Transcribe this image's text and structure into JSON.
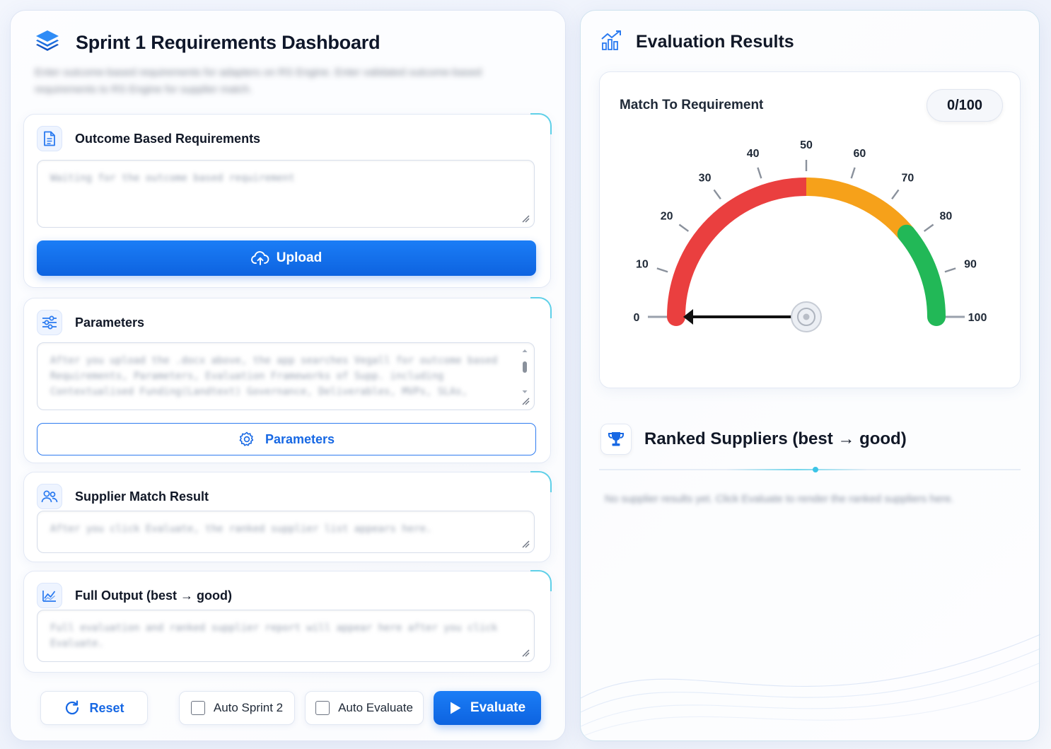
{
  "header": {
    "title": "Sprint 1 Requirements Dashboard",
    "subtitle": "Enter outcome-based requirements for adapters on RS Engine. Enter validated outcome-based requirements to RS Engine for supplier match."
  },
  "outcome": {
    "title": "Outcome Based Requirements",
    "placeholder": "Waiting for the outcome based requirement",
    "upload_label": "Upload"
  },
  "parameters": {
    "title": "Parameters",
    "placeholder": "After you upload the .docx above, the app searches Vegall for outcome based Requirements, Parameters, Evaluation Frameworks of Supp. including Contextualised Funding(Landtext) Governance, Deliverables, MVPs, SLAs,",
    "button_label": "Parameters"
  },
  "supplier_match": {
    "title": "Supplier Match Result",
    "placeholder": "After you click Evaluate, the ranked supplier list appears here."
  },
  "full_output": {
    "title": "Full Output (best → good)",
    "placeholder": "Full evaluation and ranked supplier report will appear here after you click Evaluate."
  },
  "footer": {
    "reset_label": "Reset",
    "auto_sprint2_label": "Auto Sprint 2",
    "auto_sprint2_checked": false,
    "auto_evaluate_label": "Auto Evaluate",
    "auto_evaluate_checked": false,
    "evaluate_label": "Evaluate"
  },
  "results": {
    "title": "Evaluation Results",
    "gauge_label": "Match To Requirement",
    "score_display": "0/100",
    "score": 0,
    "ticks": [
      "0",
      "10",
      "20",
      "30",
      "40",
      "50",
      "60",
      "70",
      "80",
      "90",
      "100"
    ],
    "bands": [
      {
        "from": 0,
        "to": 50,
        "color": "#ea3f3f"
      },
      {
        "from": 50,
        "to": 78,
        "color": "#f6a11a"
      },
      {
        "from": 78,
        "to": 100,
        "color": "#22b857"
      }
    ]
  },
  "ranked": {
    "title": "Ranked Suppliers (best → good)",
    "empty_text": "No supplier results yet. Click Evaluate to render the ranked suppliers here."
  },
  "colors": {
    "accent": "#0d63e0",
    "accent_teal": "#3cc4e6"
  }
}
